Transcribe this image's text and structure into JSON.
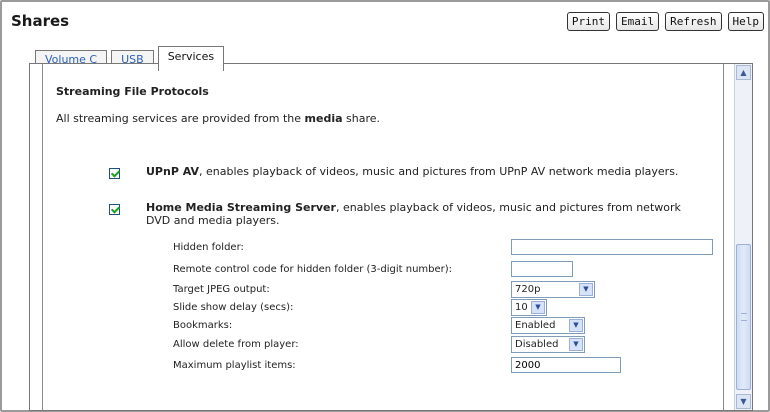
{
  "page": {
    "title": "Shares"
  },
  "toolbar": {
    "print": "Print",
    "email": "Email",
    "refresh": "Refresh",
    "help": "Help"
  },
  "tabs": [
    {
      "label": "Volume C",
      "active": false
    },
    {
      "label": "USB",
      "active": false
    },
    {
      "label": "Services",
      "active": true
    }
  ],
  "section": {
    "title": "Streaming File Protocols",
    "intro_pre": "All streaming services are provided from the ",
    "intro_bold": "media",
    "intro_post": " share."
  },
  "options": {
    "upnp": {
      "checked": true,
      "bold": "UPnP AV",
      "text": ", enables playback of videos, music and pictures from UPnP AV network media players."
    },
    "hmss": {
      "checked": true,
      "bold": "Home Media Streaming Server",
      "text": ", enables playback of videos, music and pictures from network DVD and media players."
    }
  },
  "settings": {
    "hidden_folder": {
      "label": "Hidden folder:",
      "value": ""
    },
    "remote_code": {
      "label": "Remote control code for hidden folder (3-digit number):",
      "value": ""
    },
    "jpeg": {
      "label": "Target JPEG output:",
      "value": "720p"
    },
    "slide_delay": {
      "label": "Slide show delay (secs):",
      "value": "10"
    },
    "bookmarks": {
      "label": "Bookmarks:",
      "value": "Enabled"
    },
    "allow_delete": {
      "label": "Allow delete from player:",
      "value": "Disabled"
    },
    "max_playlist": {
      "label": "Maximum playlist items:",
      "value": "2000"
    }
  },
  "icons": {
    "checkbox": "checkmark-icon",
    "dropdown": "chevron-down-icon",
    "scroll_up": "arrow-up-icon",
    "scroll_down": "arrow-down-icon"
  }
}
